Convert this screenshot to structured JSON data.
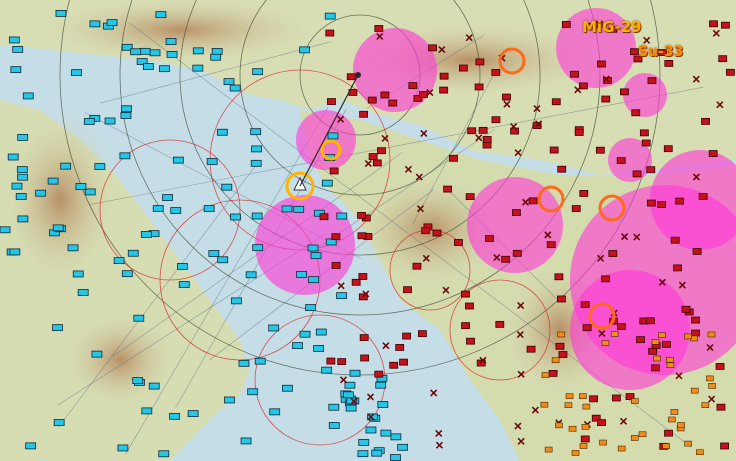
{
  "map": {
    "labels": {
      "mig29": "MiG-29",
      "su33": "Su-33"
    },
    "colors": {
      "sea": "#c5dde7",
      "land": "#d9dfb8",
      "mountain": "#c7a77a",
      "threat_ring": "#ff3ad6",
      "range_ring": "#d8282a",
      "friendly": "#25c6e6",
      "enemy": "#c4121c",
      "highlight_orange": "#ff6a1a",
      "highlight_yellow": "#ffb400",
      "label_text": "#ffb000"
    },
    "icons": {
      "friendly_unit": "blue-unit-icon",
      "enemy_unit": "red-unit-icon",
      "enemy_sam": "red-x-icon",
      "airbase": "airbase-icon"
    }
  }
}
